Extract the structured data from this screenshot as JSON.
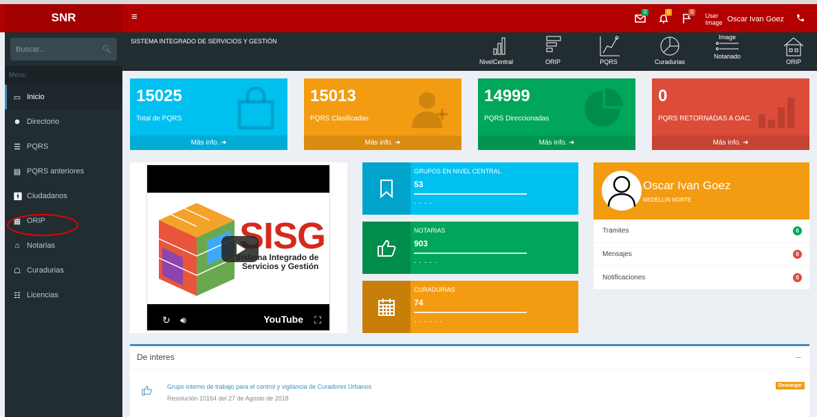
{
  "app": {
    "logo": "SNR",
    "menu_toggle": "≡"
  },
  "topbar": {
    "badges": {
      "mail": "0",
      "bell": "0",
      "flag": "0"
    },
    "user_img_alt": "User Image",
    "user_name": "Oscar Ivan Goez"
  },
  "sidebar": {
    "search_placeholder": "Buscar...",
    "menu_header": "Menu",
    "items": [
      {
        "label": "Inicio",
        "icon": "laptop-icon"
      },
      {
        "label": "Directorio",
        "icon": "users-icon"
      },
      {
        "label": "PQRS",
        "icon": "list-icon"
      },
      {
        "label": "PQRS anteriores",
        "icon": "list-alt-icon"
      },
      {
        "label": "Ciudadanos",
        "icon": "male-icon"
      },
      {
        "label": "ORIP",
        "icon": "building-icon"
      },
      {
        "label": "Notarias",
        "icon": "bank-icon"
      },
      {
        "label": "Curadurias",
        "icon": "home-icon"
      },
      {
        "label": "Licencias",
        "icon": "file-icon"
      }
    ]
  },
  "header": {
    "title": "SISTEMA INTEGRADO DE SERVICIOS Y GESTIÓN",
    "nav": [
      "NivelCentral",
      "ORIP",
      "PQRS",
      "Curadurias",
      "Notariado",
      "ORIP"
    ],
    "image_alt": "Image"
  },
  "stats": [
    {
      "value": "15025",
      "label": "Total de PQRS",
      "more": "Más info.",
      "color": "#00c0ef"
    },
    {
      "value": "15013",
      "label": "PQRS Clasificadas",
      "more": "Más info.",
      "color": "#f39c12"
    },
    {
      "value": "14999",
      "label": "PQRS Direccionadas",
      "more": "Más info.",
      "color": "#00a65a"
    },
    {
      "value": "0",
      "label": "PQRS RETORNADAS A OAC.",
      "more": "Más info.",
      "color": "#dd4b39"
    }
  ],
  "video": {
    "title": "SISG",
    "subtitle_line1": "Sistema Integrado de",
    "subtitle_line2": "Servicios y Gestión",
    "brand": "YouTube"
  },
  "info_boxes": [
    {
      "title": "GRUPOS EN NIVEL CENTRAL",
      "number": "53",
      "dashes": "- - - -",
      "color": "#00c0ef",
      "icon_bg": "#00a3cb"
    },
    {
      "title": "NOTARIAS",
      "number": "903",
      "dashes": "- - - - -",
      "color": "#00a65a",
      "icon_bg": "#008d4c"
    },
    {
      "title": "CURADURIAS",
      "number": "74",
      "dashes": "- - - - - -",
      "color": "#f39c12",
      "icon_bg": "#c87f0a"
    }
  ],
  "profile": {
    "name": "Oscar Ivan Goez",
    "location": "MEDELLIN NORTE",
    "rows": [
      {
        "label": "Tramites",
        "count": "0",
        "color": "#00a65a"
      },
      {
        "label": "Mensajes",
        "count": "0",
        "color": "#dd4b39"
      },
      {
        "label": "Notificaciones",
        "count": "0",
        "color": "#dd4b39"
      }
    ]
  },
  "interest": {
    "title": "De interes",
    "minimize": "−",
    "items": [
      {
        "title": "Grupo interno de trabajo para el control y vigilancia de Curadores Urbanos",
        "subtitle": "Resolución 10164 del 27 de Agosto de 2018",
        "action": "Descargar"
      }
    ]
  }
}
